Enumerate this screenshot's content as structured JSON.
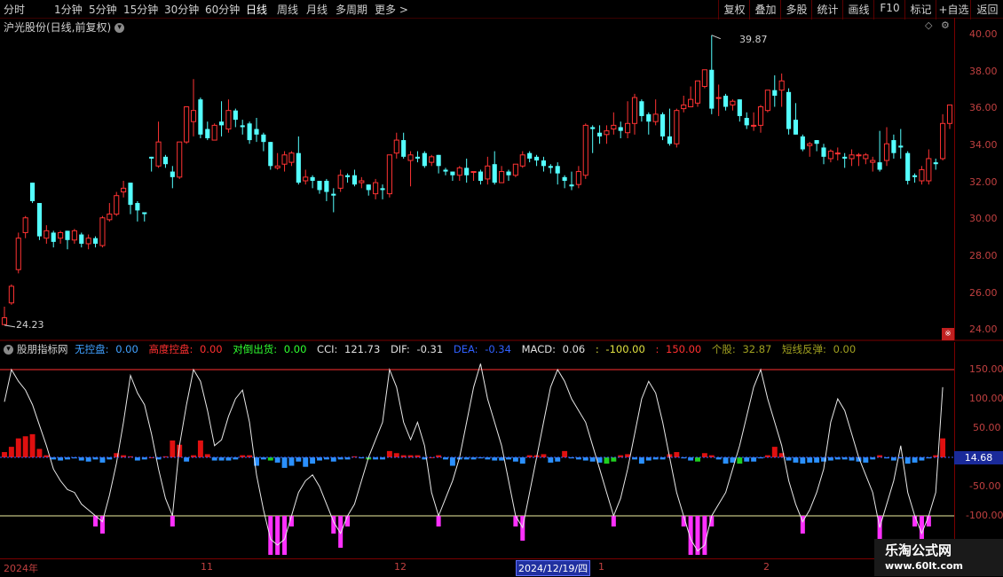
{
  "topbar": {
    "periods": [
      "分时",
      "1分钟",
      "5分钟",
      "15分钟",
      "30分钟",
      "60分钟",
      "日线",
      "周线",
      "月线",
      "多周期",
      "更多 >"
    ],
    "active_period": "日线",
    "right_buttons": [
      "复权",
      "叠加",
      "多股",
      "统计",
      "画线",
      "F10",
      "标记",
      "+自选",
      "返回"
    ]
  },
  "title": {
    "stock": "沪光股份(日线,前复权)",
    "dropdown_icon": "chevron-down-icon"
  },
  "price_axis": {
    "ticks": [
      "40.00",
      "38.00",
      "36.00",
      "34.00",
      "32.00",
      "30.00",
      "28.00",
      "26.00",
      "24.00"
    ],
    "high_label": "39.87",
    "low_label": "24.23"
  },
  "indicator": {
    "name": "股朋指标网",
    "items": [
      {
        "label": "无控盘:",
        "value": "0.00",
        "color": "#40a0ff"
      },
      {
        "label": "高度控盘:",
        "value": "0.00",
        "color": "#ff3030"
      },
      {
        "label": "对倒出货:",
        "value": "0.00",
        "color": "#30ff30"
      },
      {
        "label": "CCI:",
        "value": "121.73",
        "color": "#e0e0e0"
      },
      {
        "label": "DIF:",
        "value": "-0.31",
        "color": "#e0e0e0"
      },
      {
        "label": "DEA:",
        "value": "-0.34",
        "color": "#3060ff"
      },
      {
        "label": "MACD:",
        "value": "0.06",
        "color": "#e0e0e0"
      },
      {
        "label": ":",
        "value": "-100.00",
        "color": "#e0e040"
      },
      {
        "label": ":",
        "value": "150.00",
        "color": "#ff3030"
      },
      {
        "label": "个股:",
        "value": "32.87",
        "color": "#a0a020"
      },
      {
        "label": "短线反弹:",
        "value": "0.00",
        "color": "#a0a020"
      }
    ],
    "ticks": [
      "150.00",
      "100.00",
      "50.00",
      "-50.00",
      "-100.00"
    ],
    "cross_value": "14.68"
  },
  "dates": {
    "labels": [
      "2024年",
      "11",
      "12",
      "1",
      "2"
    ],
    "selected": "2024/12/19/四"
  },
  "watermark": {
    "line1": "乐淘公式网",
    "line2": "www.60lt.com"
  },
  "colors": {
    "up": "#ff3333",
    "down": "#54ffff",
    "grid": "#7a0000",
    "cci": "#e8e8e8"
  },
  "chart_data": {
    "type": "candlestick",
    "price_range": [
      24,
      40
    ],
    "candles": [
      [
        24.23,
        24.6,
        24.2,
        25.2
      ],
      [
        25.4,
        26.3,
        25.3,
        26.4
      ],
      [
        27.2,
        28.9,
        27.0,
        29.2
      ],
      [
        29.2,
        30.0,
        28.9,
        30.1
      ],
      [
        31.9,
        30.9,
        30.8,
        31.9
      ],
      [
        30.8,
        29.0,
        28.8,
        30.8
      ],
      [
        28.9,
        29.3,
        28.6,
        29.6
      ],
      [
        29.2,
        28.7,
        28.4,
        29.3
      ],
      [
        28.9,
        29.2,
        28.6,
        29.3
      ],
      [
        29.3,
        28.8,
        28.3,
        29.3
      ],
      [
        28.8,
        29.3,
        28.6,
        29.4
      ],
      [
        29.1,
        28.6,
        28.4,
        29.2
      ],
      [
        28.6,
        28.9,
        28.3,
        29.1
      ],
      [
        28.9,
        28.6,
        28.4,
        29.0
      ],
      [
        28.5,
        30.0,
        28.4,
        30.1
      ],
      [
        29.9,
        30.2,
        29.8,
        30.8
      ],
      [
        30.2,
        31.2,
        30.1,
        31.4
      ],
      [
        31.4,
        31.6,
        31.1,
        32.0
      ],
      [
        31.9,
        30.7,
        30.2,
        31.9
      ],
      [
        30.8,
        30.4,
        29.8,
        30.9
      ],
      [
        30.3,
        30.2,
        29.8,
        30.3
      ],
      [
        33.3,
        33.2,
        32.5,
        33.3
      ],
      [
        32.8,
        34.1,
        32.7,
        35.2
      ],
      [
        33.3,
        32.9,
        32.7,
        33.4
      ],
      [
        32.5,
        32.2,
        31.6,
        32.8
      ],
      [
        32.2,
        34.1,
        32.1,
        34.1
      ],
      [
        34.1,
        36.0,
        34.0,
        36.0
      ],
      [
        35.2,
        35.8,
        34.4,
        37.5
      ],
      [
        36.4,
        34.5,
        34.3,
        36.5
      ],
      [
        34.8,
        34.3,
        34.2,
        35.2
      ],
      [
        34.2,
        35.0,
        34.2,
        35.1
      ],
      [
        35.2,
        35.0,
        34.4,
        36.3
      ],
      [
        34.8,
        35.8,
        34.6,
        36.4
      ],
      [
        35.8,
        35.3,
        34.9,
        35.9
      ],
      [
        35.0,
        34.9,
        34.5,
        35.3
      ],
      [
        35.1,
        34.2,
        34.0,
        35.2
      ],
      [
        34.8,
        34.5,
        34.1,
        35.4
      ],
      [
        34.5,
        34.1,
        33.6,
        34.6
      ],
      [
        34.1,
        32.8,
        32.6,
        34.1
      ],
      [
        32.7,
        32.8,
        32.6,
        33.5
      ],
      [
        32.9,
        33.4,
        32.5,
        33.6
      ],
      [
        33.0,
        33.5,
        32.8,
        33.6
      ],
      [
        33.5,
        31.9,
        31.8,
        34.4
      ],
      [
        32.0,
        32.2,
        31.8,
        32.6
      ],
      [
        32.2,
        32.0,
        31.6,
        32.3
      ],
      [
        32.0,
        31.5,
        31.3,
        32.0
      ],
      [
        32.0,
        31.4,
        30.9,
        32.1
      ],
      [
        31.3,
        31.2,
        30.3,
        31.6
      ],
      [
        31.6,
        32.3,
        31.4,
        32.6
      ],
      [
        32.3,
        32.2,
        31.9,
        32.4
      ],
      [
        32.3,
        31.8,
        31.7,
        32.6
      ],
      [
        31.9,
        32.0,
        31.6,
        32.2
      ],
      [
        31.8,
        31.5,
        31.2,
        31.8
      ],
      [
        31.3,
        31.9,
        31.0,
        32.1
      ],
      [
        31.6,
        31.5,
        31.0,
        31.8
      ],
      [
        31.3,
        33.4,
        31.1,
        33.4
      ],
      [
        33.5,
        34.2,
        33.2,
        34.6
      ],
      [
        34.2,
        33.3,
        33.2,
        34.6
      ],
      [
        33.1,
        33.4,
        31.7,
        33.6
      ],
      [
        33.3,
        33.2,
        33.0,
        33.6
      ],
      [
        33.5,
        32.8,
        32.7,
        33.6
      ],
      [
        33.0,
        33.3,
        32.8,
        33.4
      ],
      [
        33.4,
        32.8,
        32.4,
        33.4
      ],
      [
        32.6,
        32.5,
        32.3,
        32.7
      ],
      [
        32.5,
        32.3,
        32.0,
        32.5
      ],
      [
        32.3,
        32.7,
        32.0,
        32.8
      ],
      [
        32.7,
        32.3,
        31.9,
        33.2
      ],
      [
        32.5,
        32.5,
        32.0,
        32.5
      ],
      [
        32.5,
        32.0,
        31.8,
        32.6
      ],
      [
        32.1,
        32.8,
        31.8,
        33.3
      ],
      [
        32.9,
        31.9,
        31.8,
        33.6
      ],
      [
        31.9,
        32.5,
        31.9,
        32.8
      ],
      [
        32.5,
        32.3,
        32.0,
        32.6
      ],
      [
        32.3,
        32.9,
        32.2,
        32.9
      ],
      [
        32.8,
        33.4,
        32.7,
        33.6
      ],
      [
        33.5,
        33.2,
        33.0,
        33.6
      ],
      [
        33.3,
        33.1,
        32.8,
        33.4
      ],
      [
        33.1,
        32.8,
        32.5,
        33.3
      ],
      [
        32.8,
        32.7,
        32.4,
        32.9
      ],
      [
        32.8,
        32.4,
        31.8,
        33.0
      ],
      [
        32.2,
        32.0,
        31.6,
        32.3
      ],
      [
        31.8,
        31.7,
        31.5,
        32.5
      ],
      [
        31.8,
        32.5,
        31.6,
        32.8
      ],
      [
        32.3,
        35.0,
        32.1,
        35.1
      ],
      [
        34.9,
        34.8,
        33.5,
        35.0
      ],
      [
        34.6,
        34.4,
        34.0,
        35.0
      ],
      [
        34.5,
        34.7,
        34.0,
        35.0
      ],
      [
        34.8,
        35.0,
        34.5,
        35.7
      ],
      [
        34.9,
        34.7,
        34.3,
        35.2
      ],
      [
        34.6,
        35.1,
        34.3,
        36.3
      ],
      [
        35.1,
        36.5,
        34.5,
        36.7
      ],
      [
        36.3,
        35.5,
        35.2,
        36.4
      ],
      [
        35.6,
        35.2,
        34.5,
        35.7
      ],
      [
        35.2,
        35.6,
        35.0,
        36.4
      ],
      [
        35.6,
        34.4,
        34.2,
        35.7
      ],
      [
        34.4,
        34.0,
        33.9,
        35.9
      ],
      [
        34.0,
        35.8,
        33.8,
        35.9
      ],
      [
        35.9,
        36.1,
        35.7,
        36.6
      ],
      [
        36.0,
        36.4,
        36.0,
        37.1
      ],
      [
        36.2,
        37.4,
        36.0,
        37.4
      ],
      [
        37.1,
        38.0,
        37.0,
        37.9
      ],
      [
        38.0,
        35.9,
        35.6,
        39.87
      ],
      [
        36.5,
        36.5,
        35.5,
        37.2
      ],
      [
        36.6,
        36.0,
        35.8,
        36.7
      ],
      [
        36.1,
        36.3,
        35.8,
        36.4
      ],
      [
        36.4,
        35.5,
        35.2,
        36.4
      ],
      [
        35.4,
        35.0,
        34.8,
        35.7
      ],
      [
        35.0,
        35.0,
        34.7,
        35.7
      ],
      [
        35.0,
        36.0,
        34.6,
        36.1
      ],
      [
        35.8,
        36.9,
        35.7,
        36.0
      ],
      [
        36.9,
        36.6,
        36.0,
        37.7
      ],
      [
        36.9,
        37.4,
        36.0,
        37.8
      ],
      [
        36.8,
        34.8,
        34.5,
        37.0
      ],
      [
        35.3,
        34.5,
        34.5,
        36.2
      ],
      [
        34.4,
        33.7,
        33.6,
        34.5
      ],
      [
        33.9,
        34.0,
        33.3,
        34.1
      ],
      [
        34.2,
        34.0,
        33.6,
        34.2
      ],
      [
        33.8,
        33.3,
        32.9,
        34.0
      ],
      [
        33.2,
        33.6,
        33.0,
        33.7
      ],
      [
        33.5,
        33.5,
        33.1,
        33.8
      ],
      [
        33.3,
        33.2,
        32.7,
        33.5
      ],
      [
        33.2,
        33.4,
        32.8,
        33.7
      ],
      [
        33.4,
        33.4,
        32.8,
        33.5
      ],
      [
        33.2,
        33.4,
        32.9,
        33.5
      ],
      [
        33.0,
        33.1,
        32.5,
        33.3
      ],
      [
        33.0,
        32.6,
        32.5,
        34.7
      ],
      [
        33.1,
        34.0,
        32.8,
        34.9
      ],
      [
        34.2,
        33.5,
        33.2,
        34.5
      ],
      [
        33.9,
        33.8,
        33.2,
        34.8
      ],
      [
        33.5,
        32.0,
        31.8,
        33.6
      ],
      [
        32.3,
        32.2,
        31.9,
        32.4
      ],
      [
        32.0,
        32.6,
        31.8,
        32.8
      ],
      [
        32.0,
        33.2,
        31.8,
        33.7
      ],
      [
        33.0,
        32.9,
        32.6,
        33.2
      ],
      [
        33.2,
        35.1,
        33.1,
        35.6
      ],
      [
        35.1,
        36.1,
        34.8,
        36.1
      ]
    ],
    "cci": [
      95,
      150,
      130,
      115,
      90,
      55,
      20,
      -20,
      -40,
      -55,
      -60,
      -80,
      -90,
      -100,
      -110,
      -65,
      -10,
      60,
      140,
      110,
      90,
      40,
      -20,
      -70,
      -100,
      20,
      90,
      150,
      130,
      80,
      20,
      30,
      70,
      100,
      115,
      60,
      -30,
      -90,
      -140,
      -150,
      -140,
      -100,
      -60,
      -40,
      -30,
      -50,
      -80,
      -110,
      -130,
      -100,
      -80,
      -40,
      0,
      30,
      60,
      150,
      120,
      60,
      30,
      60,
      20,
      -60,
      -100,
      -70,
      -40,
      0,
      60,
      120,
      160,
      100,
      60,
      20,
      -40,
      -100,
      -120,
      -60,
      0,
      60,
      120,
      150,
      130,
      100,
      80,
      60,
      20,
      -20,
      -60,
      -100,
      -70,
      -20,
      40,
      100,
      130,
      110,
      60,
      0,
      -60,
      -100,
      -140,
      -160,
      -150,
      -100,
      -80,
      -60,
      -20,
      20,
      70,
      120,
      150,
      100,
      60,
      20,
      -40,
      -80,
      -110,
      -90,
      -60,
      -20,
      60,
      100,
      80,
      40,
      0,
      -30,
      -60,
      -120,
      -80,
      -40,
      20,
      -60,
      -100,
      -130,
      -100,
      -60,
      120
    ],
    "macd_bars": [
      5,
      10,
      18,
      20,
      22,
      8,
      2,
      -2,
      -3,
      -2,
      -1,
      -3,
      -4,
      -2,
      -5,
      -2,
      4,
      2,
      1,
      -3,
      -2,
      0,
      -2,
      1,
      16,
      12,
      -4,
      2,
      16,
      3,
      -3,
      -3,
      -3,
      -2,
      2,
      2,
      -8,
      -2,
      -3,
      -5,
      -10,
      -8,
      -4,
      -9,
      -6,
      -3,
      -2,
      -4,
      -2,
      -2,
      1,
      -1,
      -2,
      -2,
      -2,
      6,
      4,
      2,
      2,
      2,
      -2,
      0,
      2,
      -2,
      -8,
      -2,
      -2,
      -2,
      -1,
      -2,
      -3,
      -3,
      -2,
      -4,
      -6,
      2,
      2,
      3,
      -5,
      -4,
      6,
      -1,
      -2,
      -3,
      -4,
      -5,
      -6,
      -4,
      2,
      3,
      -2,
      -6,
      -3,
      -2,
      -2,
      3,
      5,
      -1,
      -3,
      -4,
      4,
      2,
      -2,
      -6,
      -5,
      -6,
      -4,
      -4,
      -1,
      2,
      10,
      4,
      -3,
      -5,
      -6,
      -5,
      -5,
      -4,
      -3,
      -2,
      -2,
      -3,
      -4,
      -5,
      -2,
      2,
      -1,
      -3,
      -1,
      -6,
      -5,
      -3,
      -1,
      2,
      18
    ]
  }
}
